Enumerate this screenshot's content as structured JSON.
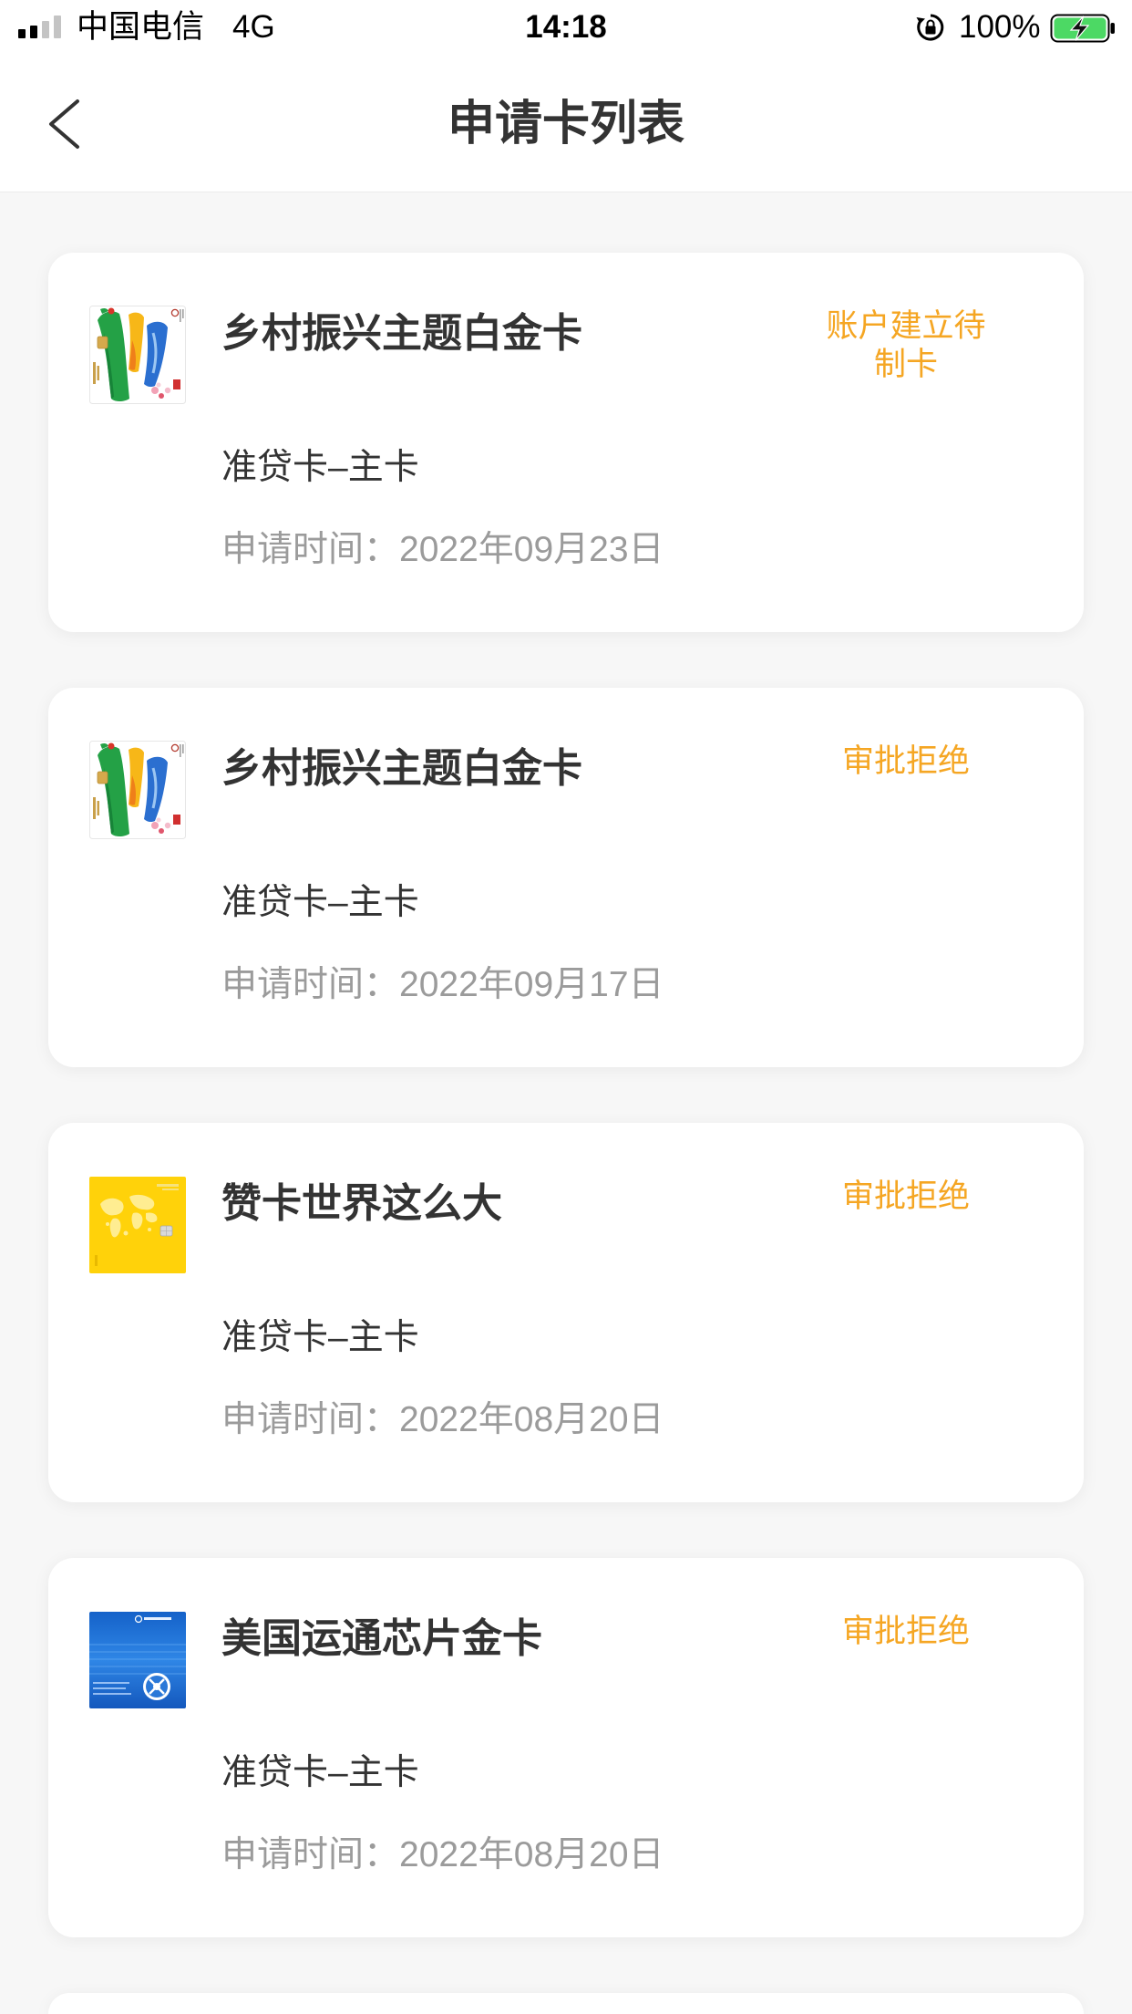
{
  "status_bar": {
    "carrier": "中国电信",
    "network": "4G",
    "time": "14:18",
    "battery_percent": "100%",
    "battery_level": 1.0,
    "battery_charging": true,
    "signal_strength": 2,
    "signal_max": 4,
    "icons": {
      "signal": "signal-icon",
      "orientation_lock": "orientation-lock-icon",
      "battery": "battery-charging-icon"
    }
  },
  "nav": {
    "title": "申请卡列表",
    "back_icon": "chevron-left-icon"
  },
  "labels": {
    "apply_time": "申请时间："
  },
  "applications": [
    {
      "card_name": "乡村振兴主题白金卡",
      "card_art": "rural-revitalization-card-art",
      "status": "账户建立待制卡",
      "card_type": "准贷卡–主卡",
      "apply_time": "2022年09月23日"
    },
    {
      "card_name": "乡村振兴主题白金卡",
      "card_art": "rural-revitalization-card-art",
      "status": "审批拒绝",
      "card_type": "准贷卡–主卡",
      "apply_time": "2022年09月17日"
    },
    {
      "card_name": "赞卡世界这么大",
      "card_art": "world-map-yellow-card-art",
      "status": "审批拒绝",
      "card_type": "准贷卡–主卡",
      "apply_time": "2022年08月20日"
    },
    {
      "card_name": "美国运通芯片金卡",
      "card_art": "amex-blue-card-art",
      "status": "审批拒绝",
      "card_type": "准贷卡–主卡",
      "apply_time": "2022年08月20日"
    }
  ],
  "colors": {
    "status_orange": "#f5a623",
    "primary_text": "#333333",
    "secondary_text": "#9b9b9b",
    "page_background": "#f7f7f7",
    "card_background": "#ffffff",
    "battery_green": "#4cd964"
  }
}
